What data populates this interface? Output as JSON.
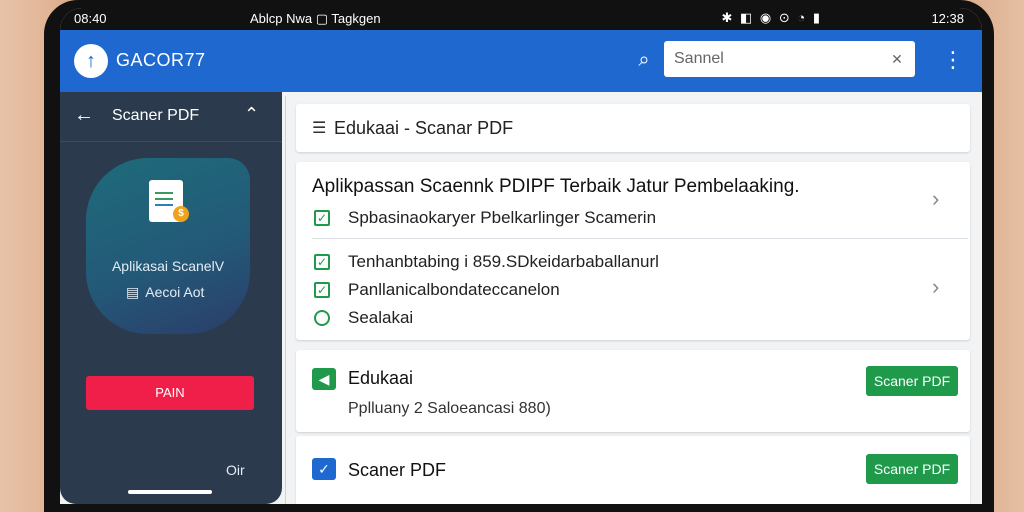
{
  "status_bar": {
    "time": "08:40",
    "center_text": "Ablcp Nwa ▢ Tagkgen",
    "icons": "✱ ◧ ◉ ⊙ ◔ ▮",
    "clock": "12:38"
  },
  "app_bar": {
    "brand": "GACOR77",
    "search_placeholder": "Sannel",
    "clear_icon": "✕",
    "menu_icon": "⋮"
  },
  "sidebar": {
    "title": "Scaner PDF",
    "card_title": "Aplikasai ScanelV",
    "card_sub": "Aecoi Aot",
    "button": "PAIN",
    "footer": "Oir"
  },
  "main": {
    "header": "Edukaai - Scanar PDF",
    "list": {
      "title": "Aplikpassan Scaennk PDIPF Terbaik Jatur Pembelaaking.",
      "items": [
        "Spbasinaokaryer Pbelkarlinger Scamerin",
        "Tenhanbtabing i 859.SDkeidarbaballanurl",
        "Panllanicalbondateccanelon",
        "Sealakai"
      ]
    },
    "cards": [
      {
        "title": "Edukaai",
        "subtitle": "Pplluany 2 Saloeancasi 880)",
        "button": "Scaner PDF",
        "icon_color": "#1f9a4b"
      },
      {
        "title": "Scaner PDF",
        "button": "Scaner PDF",
        "icon_color": "#1f68cf"
      }
    ]
  },
  "colors": {
    "app_bar": "#1f68cf",
    "sidebar": "#2b3a4d",
    "pink_button": "#f01f49",
    "green_button": "#1f9a4b"
  }
}
